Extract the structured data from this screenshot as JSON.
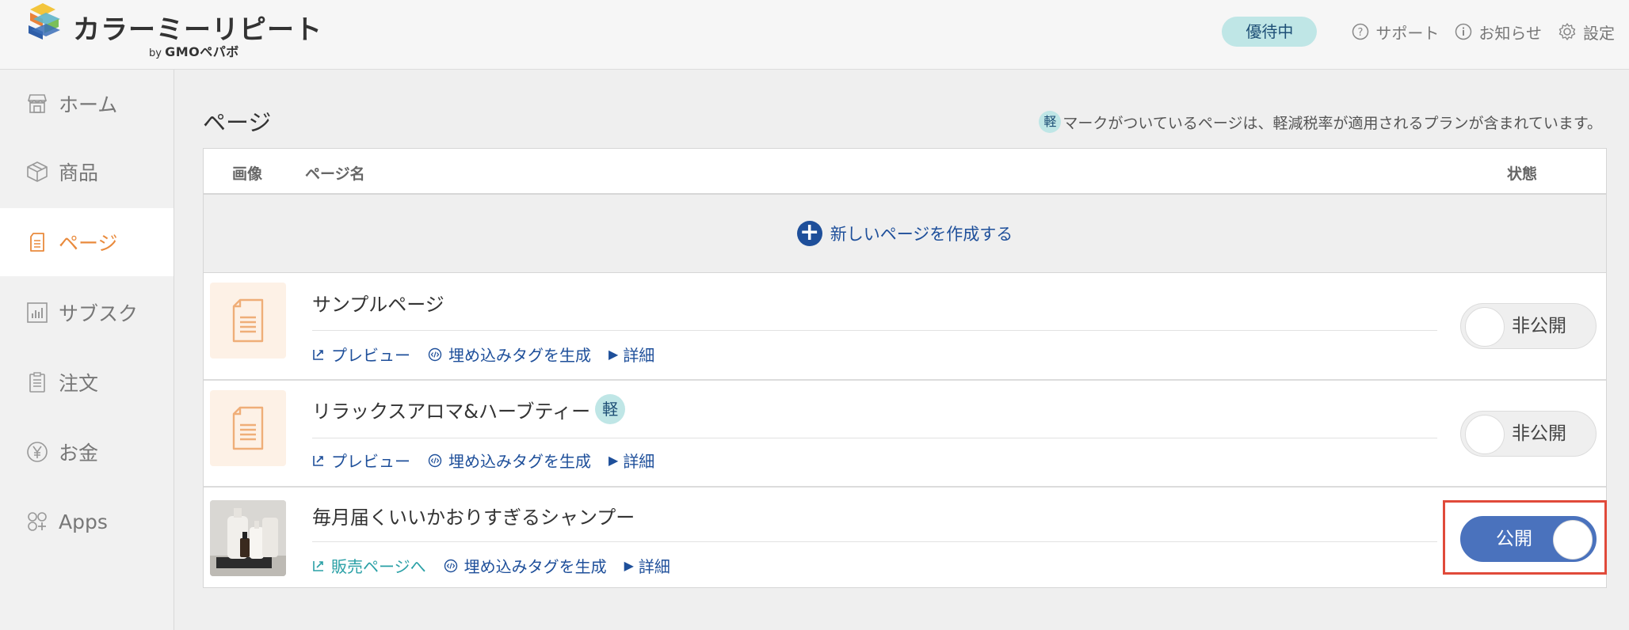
{
  "header": {
    "logo_text": "カラーミーリピート",
    "logo_by": "by",
    "logo_company": "GMOペパボ",
    "premium_badge": "優待中",
    "links": [
      {
        "icon": "question-circle-icon",
        "label": "サポート"
      },
      {
        "icon": "info-circle-icon",
        "label": "お知らせ"
      },
      {
        "icon": "gear-icon",
        "label": "設定"
      }
    ]
  },
  "sidebar": {
    "items": [
      {
        "icon": "store-icon",
        "label": "ホーム"
      },
      {
        "icon": "box-icon",
        "label": "商品"
      },
      {
        "icon": "page-icon",
        "label": "ページ",
        "active": true
      },
      {
        "icon": "bar-chart-icon",
        "label": "サブスク"
      },
      {
        "icon": "clipboard-icon",
        "label": "注文"
      },
      {
        "icon": "yen-icon",
        "label": "お金"
      },
      {
        "icon": "apps-icon",
        "label": "Apps"
      }
    ]
  },
  "main": {
    "title": "ページ",
    "notice_badge": "軽",
    "notice_text": "マークがついているページは、軽減税率が適用されるプランが含まれています。",
    "table": {
      "headers": {
        "image": "画像",
        "name": "ページ名",
        "status": "状態"
      },
      "create_label": "新しいページを作成する",
      "rows": [
        {
          "title": "サンプルページ",
          "reduced_tax": false,
          "actions": [
            "プレビュー",
            "埋め込みタグを生成",
            "詳細"
          ],
          "status": "非公開",
          "published": false
        },
        {
          "title": "リラックスアロマ&ハーブティー",
          "reduced_tax": true,
          "reduced_tax_label": "軽",
          "actions": [
            "プレビュー",
            "埋め込みタグを生成",
            "詳細"
          ],
          "status": "非公開",
          "published": false
        },
        {
          "title": "毎月届くいいかおりすぎるシャンプー",
          "reduced_tax": false,
          "actions": [
            "販売ページへ",
            "埋め込みタグを生成",
            "詳細"
          ],
          "status": "公開",
          "published": true
        }
      ]
    }
  },
  "colors": {
    "accent_orange": "#e98a3c",
    "link_blue": "#1e4f9a",
    "toggle_on": "#4a72bd",
    "badge_teal": "#bfe6e6",
    "highlight_red": "#e04a3a"
  }
}
